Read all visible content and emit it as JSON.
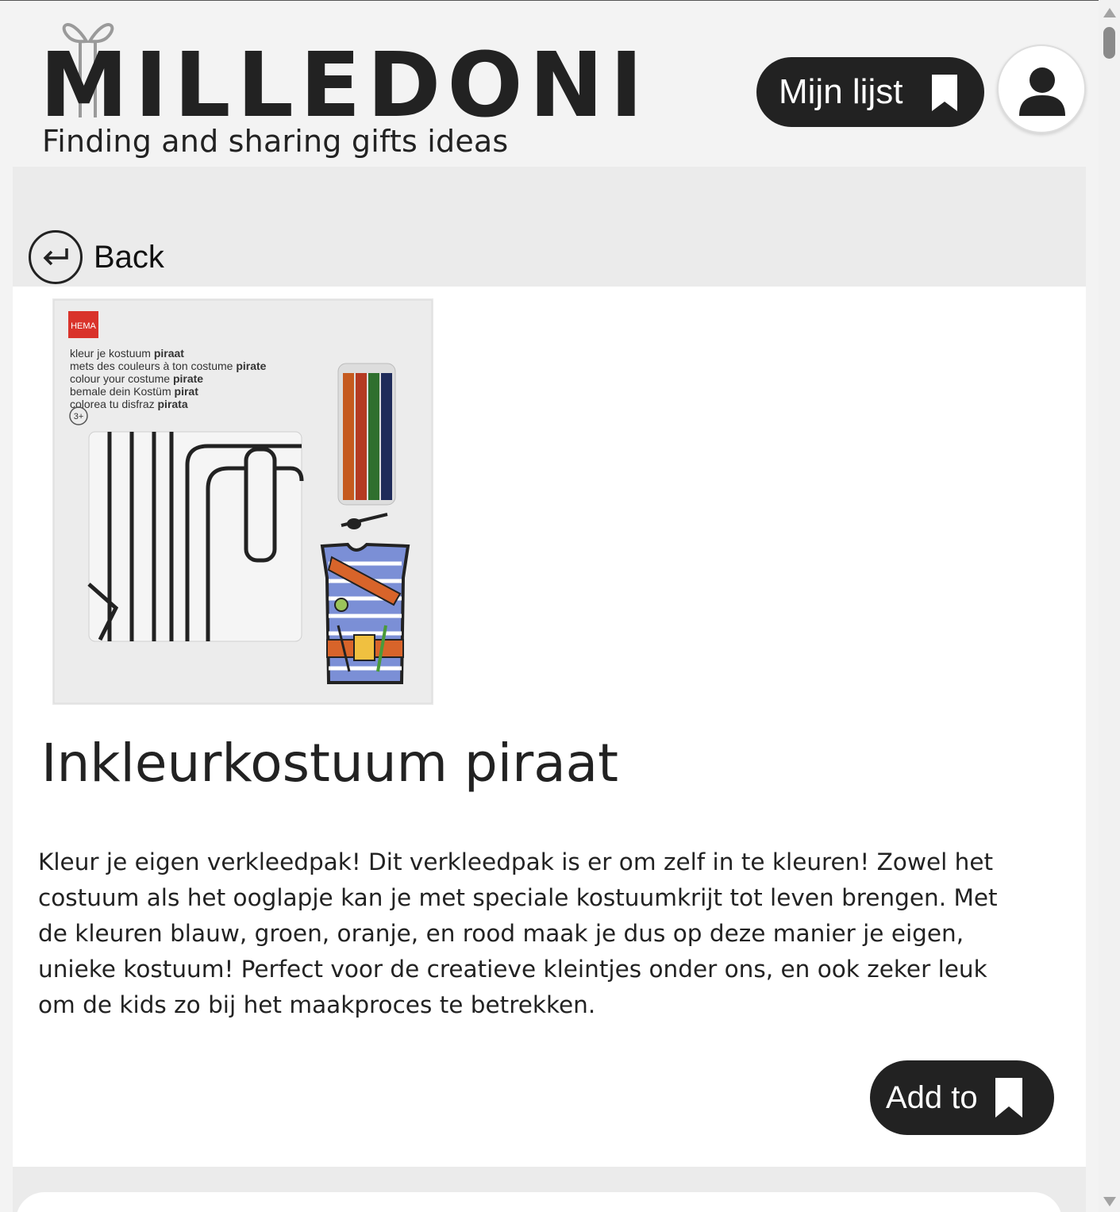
{
  "brand": {
    "name": "MILLEDONI",
    "tagline": "Finding and sharing gifts ideas"
  },
  "header": {
    "my_list_label": "Mijn lijst"
  },
  "nav": {
    "back_label": "Back"
  },
  "product": {
    "image": {
      "store_badge": "HEMA",
      "lines": [
        {
          "plain": "kleur je kostuum ",
          "bold": "piraat"
        },
        {
          "plain": "mets des couleurs à ton costume ",
          "bold": "pirate"
        },
        {
          "plain": "colour your costume ",
          "bold": "pirate"
        },
        {
          "plain": "bemale dein Kostüm ",
          "bold": "pirat"
        },
        {
          "plain": "colorea tu disfraz ",
          "bold": "pirata"
        }
      ],
      "age": "3+"
    },
    "title": "Inkleurkostuum piraat",
    "description": "Kleur je eigen verkleedpak! Dit verkleedpak is er om zelf in te kleuren! Zowel het costuum als het ooglapje kan je met speciale kostuumkrijt tot leven brengen. Met de kleuren blauw, groen, oranje, en rood maak je dus op deze manier je eigen, unieke kostuum! Perfect voor de creatieve kleintjes onder ons, en ook zeker leuk om de kids zo bij het maakproces te betrekken.",
    "add_label": "Add to"
  },
  "colors": {
    "dark": "#222222",
    "band": "#ebebeb",
    "page_bg": "#f3f3f3",
    "badge_red": "#d9332b"
  },
  "icons": {
    "bookmark": "bookmark-icon",
    "account": "user-icon",
    "back": "return-arrow-icon"
  }
}
